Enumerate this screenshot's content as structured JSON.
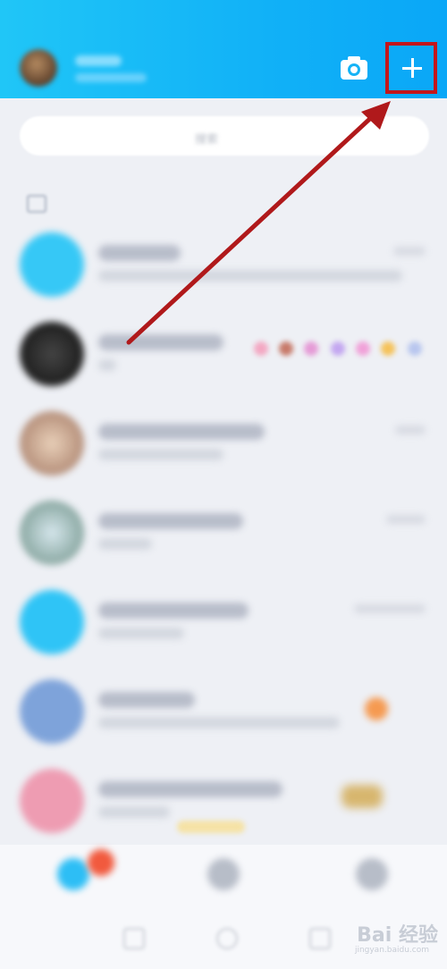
{
  "header": {
    "camera_icon": "camera-icon",
    "plus_icon": "plus-icon",
    "highlight_color": "#c3161c"
  },
  "search": {
    "placeholder": "搜索"
  },
  "colors": {
    "header_start": "#20c6f7",
    "header_end": "#0aa7f7",
    "arrow": "#b0191b"
  },
  "watermark": {
    "brand": "Bai",
    "suffix": "经验",
    "url": "jingyan.baidu.com"
  }
}
